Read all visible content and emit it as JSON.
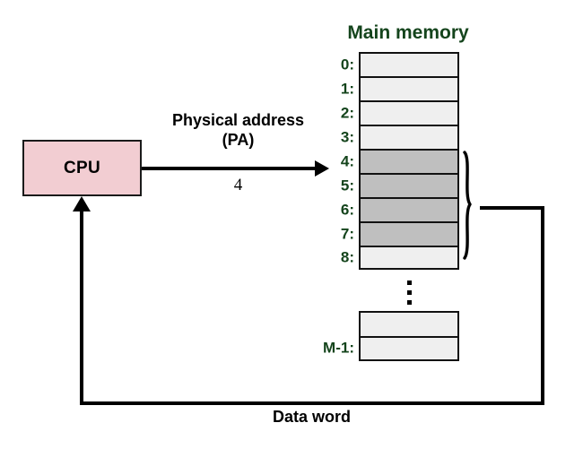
{
  "diagram": {
    "title_main_memory": "Main memory",
    "cpu": {
      "label": "CPU"
    },
    "physical_address": {
      "label_line1": "Physical address",
      "label_line2": "(PA)",
      "value": "4"
    },
    "data_word": {
      "label": "Data word"
    },
    "memory": {
      "rows": [
        {
          "index": "0:",
          "shaded": false
        },
        {
          "index": "1:",
          "shaded": false
        },
        {
          "index": "2:",
          "shaded": false
        },
        {
          "index": "3:",
          "shaded": false
        },
        {
          "index": "4:",
          "shaded": true
        },
        {
          "index": "5:",
          "shaded": true
        },
        {
          "index": "6:",
          "shaded": true
        },
        {
          "index": "7:",
          "shaded": true
        },
        {
          "index": "8:",
          "shaded": false
        }
      ],
      "ellipsis": "⋮",
      "tail_rows": [
        {
          "index": "",
          "shaded": false
        },
        {
          "index": "M-1:",
          "shaded": false
        }
      ]
    },
    "colors": {
      "cpu_fill": "#f2cdd2",
      "memory_cell_fill": "#efefef",
      "memory_cell_shaded_fill": "#bfbfbf",
      "label_green": "#14441c",
      "stroke_black": "#111111"
    },
    "icons": {
      "address_arrow": "arrow-right-icon",
      "data_word_arrow": "arrow-up-icon",
      "grouping_brace": "curly-brace-icon",
      "continuation": "vertical-ellipsis-icon"
    }
  }
}
